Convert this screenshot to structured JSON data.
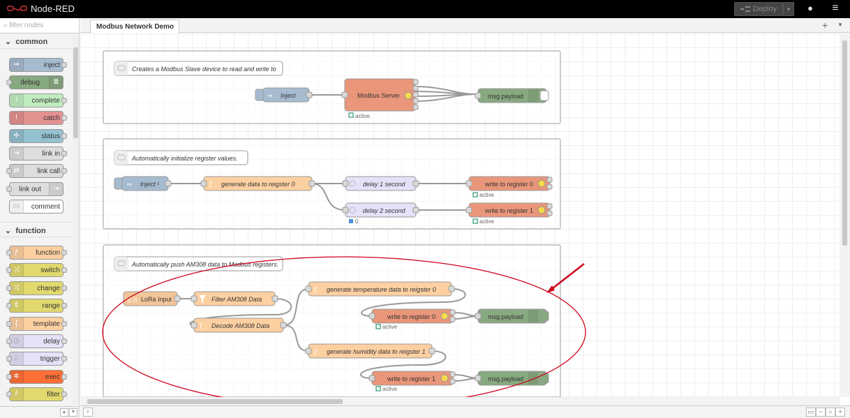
{
  "app": {
    "title": "Node-RED"
  },
  "header": {
    "deploy_label": "Deploy"
  },
  "palette": {
    "filter_placeholder": "filter nodes",
    "categories": [
      {
        "name": "common",
        "nodes": [
          "inject",
          "debug",
          "complete",
          "catch",
          "status",
          "link in",
          "link call",
          "link out",
          "comment"
        ]
      },
      {
        "name": "function",
        "nodes": [
          "function",
          "switch",
          "change",
          "range",
          "template",
          "delay",
          "trigger",
          "exec",
          "filter"
        ]
      }
    ]
  },
  "tabs": [
    {
      "label": "Modbus Network Demo"
    }
  ],
  "flow": {
    "groups": [
      {
        "comment": "Creates a Modbus Slave device to read and write to",
        "inject": "Inject",
        "server": "Modbus Server",
        "server_status": "active",
        "debug": "msg.payload"
      },
      {
        "comment": "Automatically initialize register values.",
        "inject": "Inject ¹",
        "function": "generate data to reigster 0",
        "delay1": "delay 1 second",
        "delay2": "delay 2 second",
        "delay2_status": "0",
        "write0": "write to register 0",
        "write0_status": "active",
        "write1": "write to register 1",
        "write1_status": "active"
      },
      {
        "comment": "Automatically push AM308 data to Modbus registers.",
        "lora": "LoRa Input",
        "filter": "Filter AM308 Data",
        "decode": "Decode AM308 Data",
        "gen_temp": "generate temperature data to reigster 0",
        "write0": "write to register 0",
        "write0_status": "active",
        "debug0": "msg.payload",
        "gen_hum": "generate humidity data to reigster 1",
        "write1": "write to register 1",
        "write1_status": "active",
        "debug1": "msg.payload"
      }
    ]
  },
  "colors": {
    "header_bg": "#000000",
    "inject": "#a6bbcf",
    "debug": "#87a980",
    "complete": "#c0edc0",
    "catch": "#e49191",
    "status": "#94c1d0",
    "link": "#dddddd",
    "function": "#fdd0a2",
    "switch": "#e2d96e",
    "range": "#e2d96e",
    "template": "#fdd0a2",
    "delay": "#e6e0f8",
    "exec": "#fd6f37",
    "modbus": "#e9967a",
    "lora": "#f3c59a",
    "annotation": "#d0021b"
  }
}
